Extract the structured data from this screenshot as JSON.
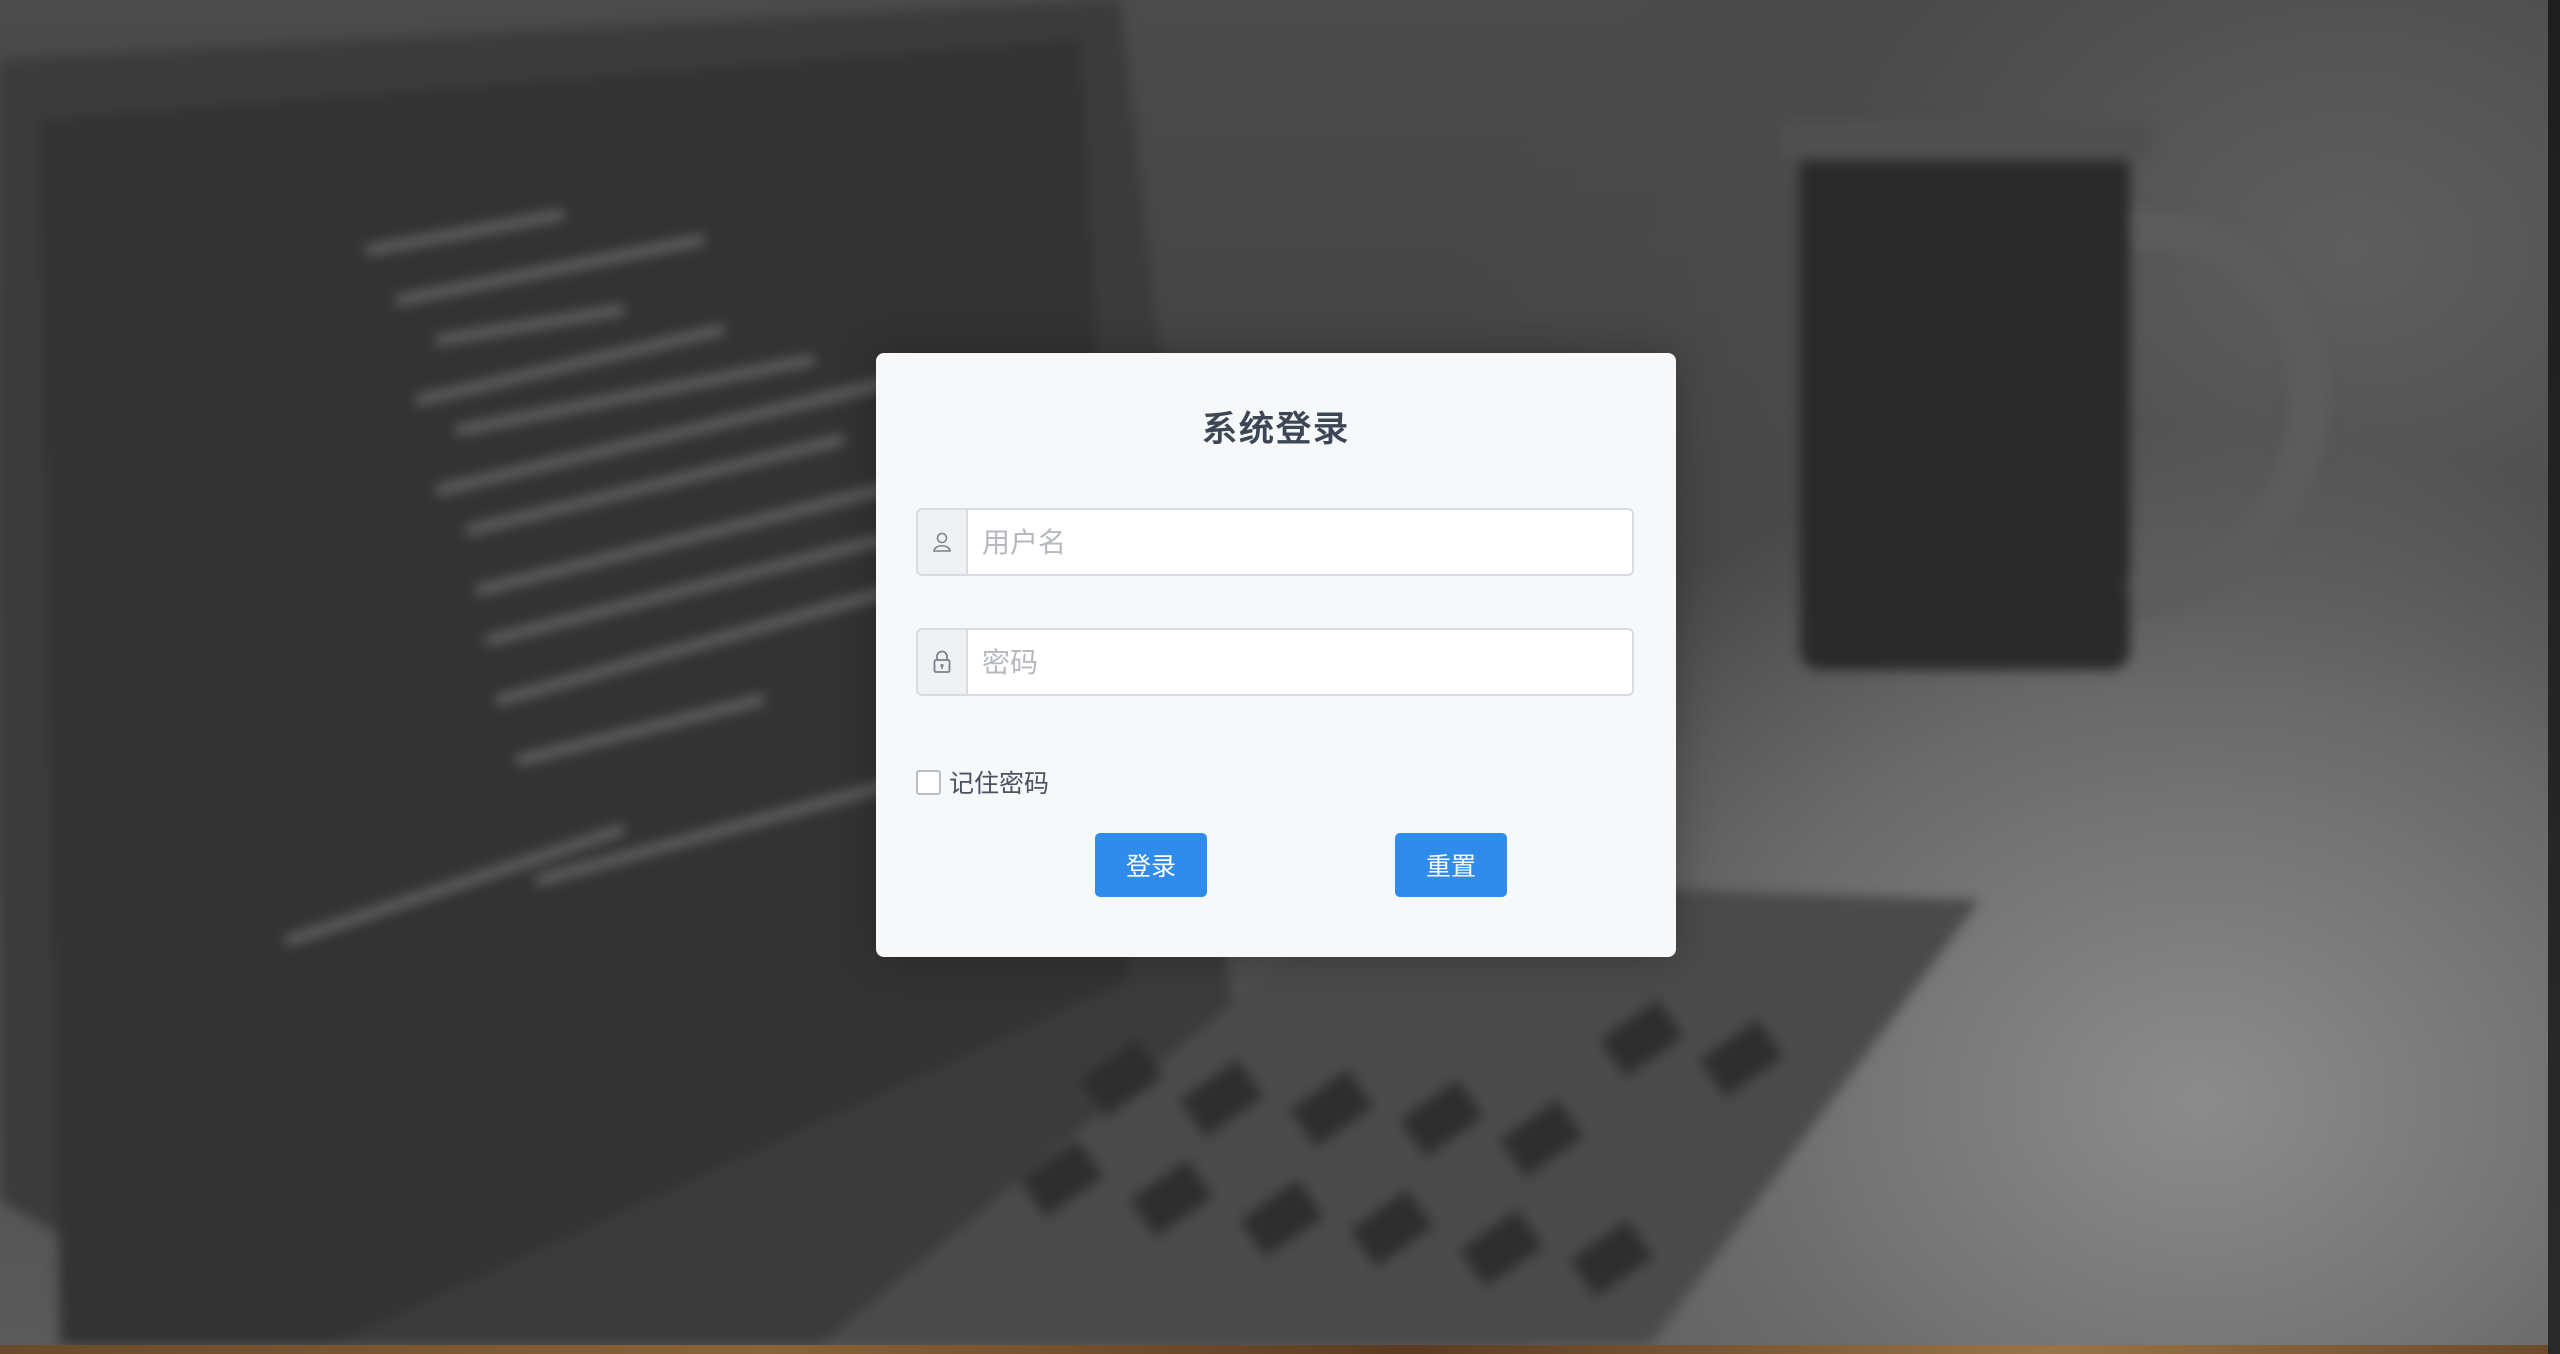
{
  "login": {
    "title": "系统登录",
    "username": {
      "placeholder": "用户名",
      "value": "",
      "icon": "user-icon"
    },
    "password": {
      "placeholder": "密码",
      "value": "",
      "icon": "lock-icon"
    },
    "remember_label": "记住密码",
    "remember_checked": false,
    "login_label": "登录",
    "reset_label": "重置"
  },
  "colors": {
    "primary": "#2f8ceb",
    "card_bg": "#f6f8fa",
    "title": "#3d4655",
    "placeholder": "#b5b8be"
  }
}
